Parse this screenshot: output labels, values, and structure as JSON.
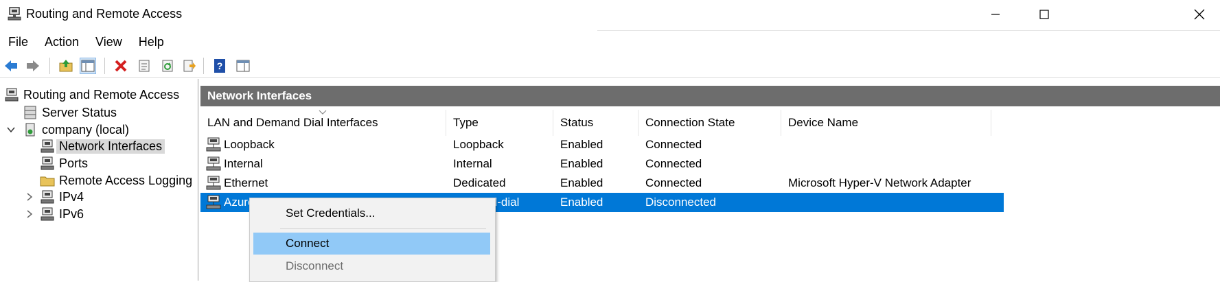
{
  "window": {
    "title": "Routing and Remote Access",
    "minimize_icon": "minimize-icon",
    "maximize_icon": "maximize-icon",
    "close_icon": "close-icon"
  },
  "menu": [
    "File",
    "Action",
    "View",
    "Help"
  ],
  "toolbar": {
    "icons": [
      "back-arrow-icon",
      "forward-arrow-icon",
      "up-folder-icon",
      "show-hide-tree-icon",
      "delete-icon",
      "properties-icon",
      "refresh-icon",
      "export-list-icon",
      "help-icon",
      "show-hide-action-pane-icon"
    ],
    "colors": {
      "back_arrow": "#2b7cd3",
      "delete_x": "#d41f1f",
      "help_blue": "#1f4fa8"
    }
  },
  "tree": {
    "root": "Routing and Remote Access",
    "items": [
      {
        "label": "Server Status",
        "icon": "server-status-icon"
      },
      {
        "label": "company (local)",
        "icon": "server-icon",
        "expanded": true
      },
      {
        "label": "Network Interfaces",
        "icon": "network-interfaces-icon",
        "selected": true
      },
      {
        "label": "Ports",
        "icon": "ports-icon"
      },
      {
        "label": "Remote Access Logging",
        "icon": "folder-icon"
      },
      {
        "label": "IPv4",
        "icon": "ipv4-icon",
        "expanded": false
      },
      {
        "label": "IPv6",
        "icon": "ipv6-icon",
        "expanded": false
      }
    ]
  },
  "pane": {
    "header": "Network Interfaces",
    "columns": [
      "LAN and Demand Dial Interfaces",
      "Type",
      "Status",
      "Connection State",
      "Device Name"
    ],
    "rows": [
      {
        "name": "Loopback",
        "type": "Loopback",
        "status": "Enabled",
        "state": "Connected",
        "device": ""
      },
      {
        "name": "Internal",
        "type": "Internal",
        "status": "Enabled",
        "state": "Connected",
        "device": ""
      },
      {
        "name": "Ethernet",
        "type": "Dedicated",
        "status": "Enabled",
        "state": "Connected",
        "device": "Microsoft Hyper-V Network Adapter"
      },
      {
        "name": "Azure",
        "type": "Demand-dial",
        "status": "Enabled",
        "state": "Disconnected",
        "device": "",
        "selected": true
      }
    ],
    "selection_color": "#0078d7"
  },
  "context_menu": {
    "items": [
      "Set Credentials...",
      "Connect",
      "Disconnect"
    ],
    "highlighted": "Connect",
    "disabled": "Disconnect",
    "highlight_color": "#91c9f7"
  }
}
